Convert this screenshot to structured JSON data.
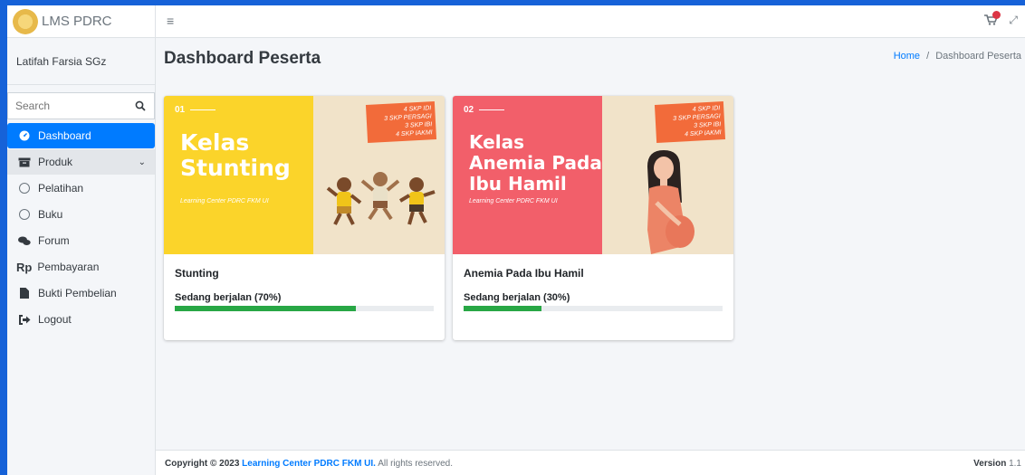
{
  "brand": {
    "name": "LMS PDRC"
  },
  "user": {
    "name": "Latifah Farsia SGz"
  },
  "search": {
    "placeholder": "Search"
  },
  "sidebar": {
    "items": [
      {
        "label": "Dashboard",
        "icon": "dashboard-icon"
      },
      {
        "label": "Produk",
        "icon": "box-icon"
      },
      {
        "label": "Pelatihan",
        "icon": "circle-icon"
      },
      {
        "label": "Buku",
        "icon": "circle-icon"
      },
      {
        "label": "Forum",
        "icon": "comments-icon"
      },
      {
        "label": "Pembayaran",
        "icon": "rupiah-icon",
        "prefix": "Rp"
      },
      {
        "label": "Bukti Pembelian",
        "icon": "file-icon"
      },
      {
        "label": "Logout",
        "icon": "sign-out-icon"
      }
    ]
  },
  "page": {
    "title": "Dashboard Peserta",
    "breadcrumb": {
      "home": "Home",
      "separator": "/",
      "current": "Dashboard Peserta"
    }
  },
  "courses": [
    {
      "number": "01",
      "banner_title_1": "Kelas",
      "banner_title_2": "Stunting",
      "banner_title_3": "",
      "tagline": "Learning Center PDRC FKM UI",
      "skp": [
        "4 SKP IDI",
        "3 SKP PERSAGI",
        "3 SKP IBI",
        "4 SKP IAKMI"
      ],
      "name": "Stunting",
      "status": "Sedang berjalan (70%)",
      "progress": 0.7,
      "color": "#fbd42a"
    },
    {
      "number": "02",
      "banner_title_1": "Kelas",
      "banner_title_2": "Anemia Pada",
      "banner_title_3": "Ibu Hamil",
      "tagline": "Learning Center PDRC FKM UI",
      "skp": [
        "4 SKP IDI",
        "3 SKP PERSAGI",
        "3 SKP IBI",
        "4 SKP IAKMI"
      ],
      "name": "Anemia Pada Ibu Hamil",
      "status": "Sedang berjalan (30%)",
      "progress": 0.3,
      "color": "#f25f6a"
    }
  ],
  "footer": {
    "copyright_prefix": "Copyright © 2023",
    "org": "Learning Center PDRC FKM UI.",
    "suffix": "All rights reserved.",
    "version_label": "Version",
    "version": "1.1"
  },
  "colors": {
    "accent": "#007bff",
    "progress": "#28a745",
    "badge": "#dc3545"
  }
}
